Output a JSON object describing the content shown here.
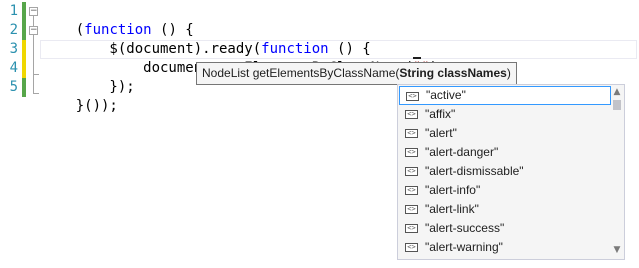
{
  "editor": {
    "line_numbers": [
      "1",
      "2",
      "3",
      "4",
      "5"
    ],
    "lines": [
      [
        {
          "t": "(",
          "c": ""
        },
        {
          "t": "function",
          "c": "kw"
        },
        {
          "t": " () {",
          "c": ""
        }
      ],
      [
        {
          "t": "    $(document).ready(",
          "c": ""
        },
        {
          "t": "function",
          "c": "kw"
        },
        {
          "t": " () {",
          "c": ""
        }
      ],
      [
        {
          "t": "        document.getElementsByClassName(",
          "c": ""
        },
        {
          "t": "\"\"",
          "c": "str"
        },
        {
          "t": ")",
          "c": ""
        }
      ],
      [
        {
          "t": "    });",
          "c": ""
        }
      ],
      [
        {
          "t": "}());",
          "c": ""
        }
      ]
    ],
    "colors": {
      "line_number": "#2b91af",
      "keyword": "#0000ff",
      "string": "#a31515",
      "saved_change": "#57a64a",
      "unsaved_change": "#efd700"
    }
  },
  "signature_tooltip": {
    "prefix": "NodeList getElementsByClassName(",
    "param": "String classNames",
    "suffix": ")"
  },
  "completion": {
    "icon": "css-class-icon",
    "selected_index": 0,
    "items": [
      "\"active\"",
      "\"affix\"",
      "\"alert\"",
      "\"alert-danger\"",
      "\"alert-dismissable\"",
      "\"alert-info\"",
      "\"alert-link\"",
      "\"alert-success\"",
      "\"alert-warning\""
    ]
  }
}
